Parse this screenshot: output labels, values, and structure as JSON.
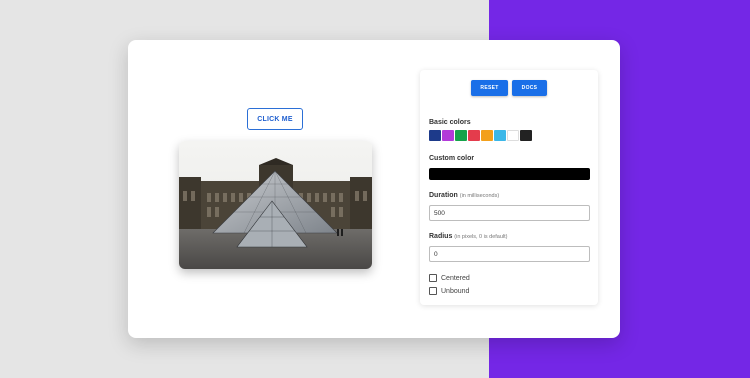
{
  "demo": {
    "click_label": "CLICK ME",
    "image_alt": "Louvre pyramid"
  },
  "panel": {
    "reset_label": "RESET",
    "docs_label": "DOCS",
    "basic_colors_label": "Basic colors",
    "swatches": [
      "#1d3a8a",
      "#b23ad9",
      "#15a34a",
      "#e43c4c",
      "#f3a01b",
      "#3bb7e8",
      "#ffffff",
      "#222222"
    ],
    "custom_color_label": "Custom color",
    "custom_color_value": "#000000",
    "duration_label": "Duration",
    "duration_hint": "(in milliseconds)",
    "duration_value": "500",
    "radius_label": "Radius",
    "radius_hint": "(in pixels, 0 is default)",
    "radius_value": "0",
    "centered_label": "Centered",
    "centered_checked": false,
    "unbound_label": "Unbound",
    "unbound_checked": false
  },
  "colors": {
    "accent": "#1a6fe8",
    "background_right": "#7427e6",
    "background_left": "#e5e5e5"
  }
}
